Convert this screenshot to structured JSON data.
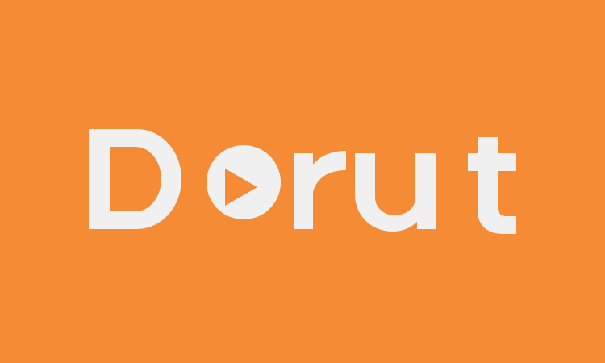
{
  "brand": {
    "name": "Dorut",
    "colors": {
      "background": "#f58c35",
      "logo": "#f0f0f0"
    },
    "logo_icon": "play-icon"
  }
}
